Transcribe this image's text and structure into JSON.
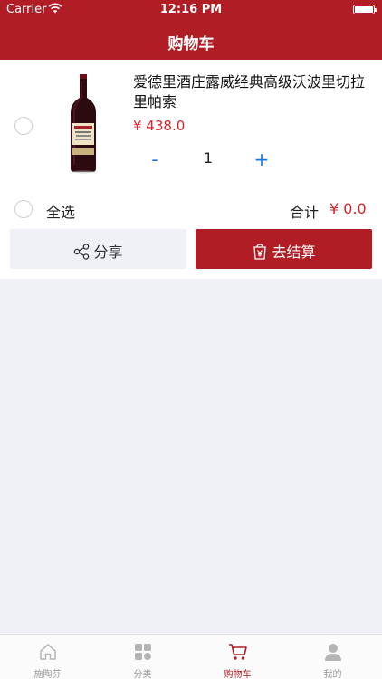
{
  "status_bar": {
    "carrier": "Carrier",
    "time": "12:16 PM"
  },
  "navbar": {
    "title": "购物车"
  },
  "cart": {
    "items": [
      {
        "name": "爱德里酒庄露威经典高级沃波里切拉里帕索",
        "price": "¥ 438.0",
        "quantity": "1",
        "minus_label": "-",
        "plus_label": "+",
        "image_icon": "wine-bottle-icon"
      }
    ],
    "select_all_label": "全选",
    "total_label": "合计",
    "total_value": "¥ 0.0",
    "share_label": "分享",
    "checkout_label": "去结算"
  },
  "tabbar": {
    "tabs": [
      {
        "label": "施陶芬",
        "icon": "home-icon",
        "active": false
      },
      {
        "label": "分类",
        "icon": "category-icon",
        "active": false
      },
      {
        "label": "购物车",
        "icon": "cart-icon",
        "active": true
      },
      {
        "label": "我的",
        "icon": "person-icon",
        "active": false
      }
    ]
  },
  "colors": {
    "brand": "#b01d24",
    "price": "#d9232b",
    "qty_control": "#1577e8",
    "background": "#eff1f7"
  }
}
